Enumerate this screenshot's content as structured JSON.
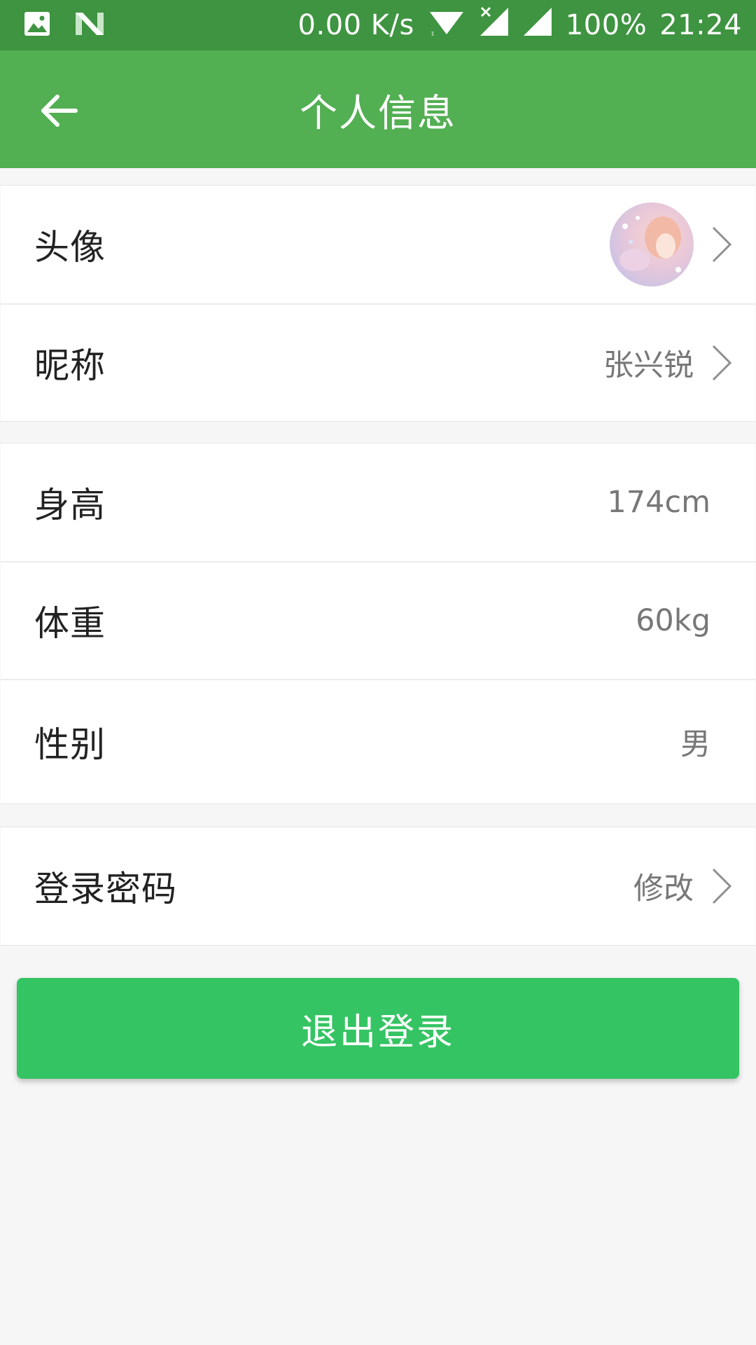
{
  "status_bar": {
    "network_speed": "0.00 K/s",
    "battery": "100%",
    "time": "21:24"
  },
  "header": {
    "title": "个人信息"
  },
  "profile": {
    "avatar_label": "头像",
    "nickname_label": "昵称",
    "nickname_value": "张兴锐"
  },
  "body_info": {
    "height_label": "身高",
    "height_value": "174cm",
    "weight_label": "体重",
    "weight_value": "60kg",
    "gender_label": "性别",
    "gender_value": "男"
  },
  "security": {
    "password_label": "登录密码",
    "password_action": "修改"
  },
  "logout_button": {
    "label": "退出登录"
  },
  "colors": {
    "status_bar": "#3e9440",
    "app_bar": "#52af52",
    "logout_button": "#35c463",
    "background": "#f6f6f6"
  },
  "icons": {
    "back": "arrow-left-icon",
    "chevron": "chevron-right-icon"
  }
}
